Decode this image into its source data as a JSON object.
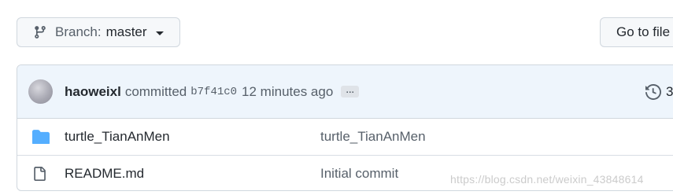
{
  "branch": {
    "prefix": "Branch:",
    "name": "master",
    "icon": "git-branch-icon"
  },
  "go_to_file": {
    "label": "Go to file"
  },
  "commit": {
    "author": "haoweixl",
    "verb": "committed",
    "sha": "b7f41c0",
    "time_ago": "12 minutes ago",
    "ellipsis": "…",
    "history_count": "3"
  },
  "files": [
    {
      "type": "directory",
      "icon": "folder-icon",
      "name": "turtle_TianAnMen",
      "message": "turtle_TianAnMen"
    },
    {
      "type": "file",
      "icon": "file-icon",
      "name": "README.md",
      "message": "Initial commit"
    }
  ],
  "watermark": "https://blog.csdn.net/weixin_43848614",
  "colors": {
    "border": "#d0d7de",
    "button_bg": "#f6f8fa",
    "commit_bar_bg": "#eef5fc",
    "folder_blue": "#54aeff",
    "text": "#24292f",
    "muted": "#57606a"
  }
}
